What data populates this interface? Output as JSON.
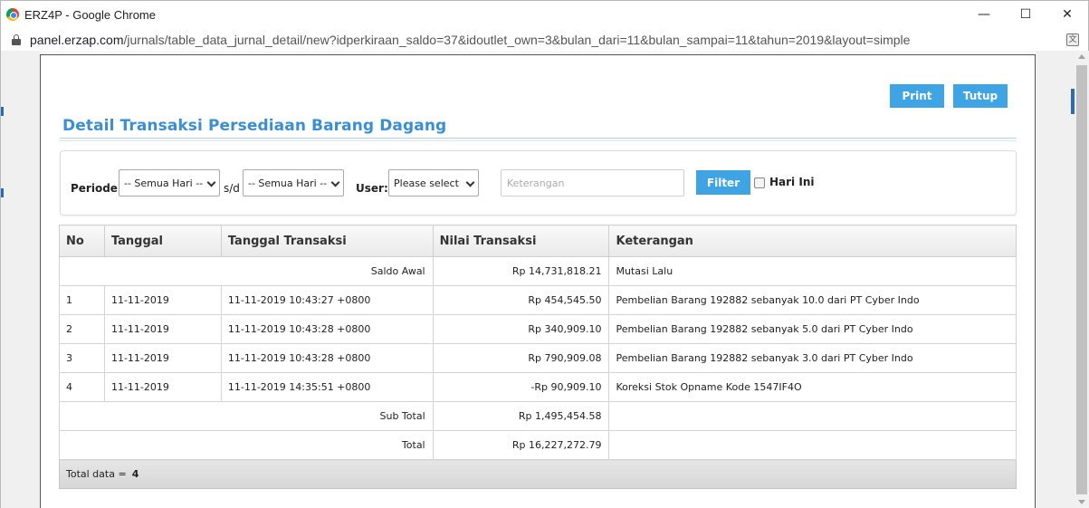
{
  "window": {
    "title": "ERZ4P - Google Chrome",
    "controls": [
      "—",
      "☐",
      "✕"
    ]
  },
  "address": {
    "host": "panel.erzap.com",
    "path": "/jurnals/table_data_jurnal_detail/new?idperkiraan_saldo=37&idoutlet_own=3&bulan_dari=11&bulan_sampai=11&tahun=2019&layout=simple"
  },
  "actions": {
    "print": "Print",
    "close": "Tutup"
  },
  "page": {
    "title": "Detail Transaksi Persediaan Barang Dagang"
  },
  "filter": {
    "periode_label": "Periode:",
    "periode_from": "-- Semua Hari --",
    "separator": "s/d",
    "periode_to": "-- Semua Hari --",
    "user_label": "User:",
    "user_value": "Please select",
    "keterangan_placeholder": "Keterangan",
    "filter_button": "Filter",
    "today_label": "Hari Ini"
  },
  "table": {
    "headers": [
      "No",
      "Tanggal",
      "Tanggal Transaksi",
      "Nilai Transaksi",
      "Keterangan"
    ],
    "opening": {
      "label": "Saldo Awal",
      "value": "Rp 14,731,818.21",
      "note": "Mutasi Lalu"
    },
    "rows": [
      {
        "no": "1",
        "tanggal": "11-11-2019",
        "tanggal_transaksi": "11-11-2019 10:43:27 +0800",
        "nilai": "Rp 454,545.50",
        "keterangan": "Pembelian Barang 192882 sebanyak 10.0 dari PT Cyber Indo"
      },
      {
        "no": "2",
        "tanggal": "11-11-2019",
        "tanggal_transaksi": "11-11-2019 10:43:28 +0800",
        "nilai": "Rp 340,909.10",
        "keterangan": "Pembelian Barang 192882 sebanyak 5.0 dari PT Cyber Indo"
      },
      {
        "no": "3",
        "tanggal": "11-11-2019",
        "tanggal_transaksi": "11-11-2019 10:43:28 +0800",
        "nilai": "Rp 790,909.08",
        "keterangan": "Pembelian Barang 192882 sebanyak 3.0 dari PT Cyber Indo"
      },
      {
        "no": "4",
        "tanggal": "11-11-2019",
        "tanggal_transaksi": "11-11-2019 14:35:51 +0800",
        "nilai": "-Rp 90,909.10",
        "keterangan": "Koreksi Stok Opname Kode 1547IF4O"
      }
    ],
    "subtotal": {
      "label": "Sub Total",
      "value": "Rp 1,495,454.58"
    },
    "total": {
      "label": "Total",
      "value": "Rp 16,227,272.79"
    },
    "footer": {
      "label": "Total data =",
      "count": "4"
    }
  },
  "colors": {
    "accent": "#3fa4e3",
    "title": "#3a8fd3"
  }
}
